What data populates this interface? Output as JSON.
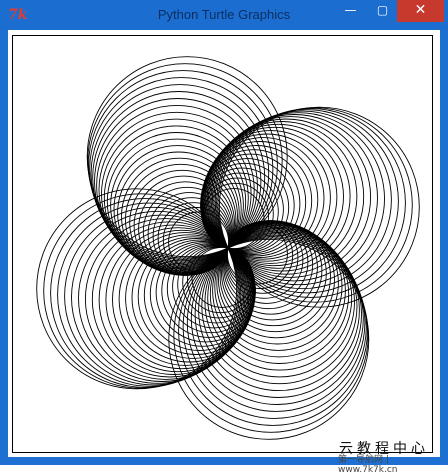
{
  "window": {
    "title": "Python Turtle Graphics",
    "icon_text": "7k",
    "controls": {
      "minimize": "—",
      "maximize": "▢",
      "close": "✕"
    }
  },
  "watermark": {
    "main": "云教程中心",
    "sub": "第一导航网 | www.7k7k.cn"
  },
  "colors": {
    "titlebar": "#1b6ed0",
    "close": "#c7382d",
    "stroke": "#000000"
  },
  "icons": [
    "tk-icon",
    "minimize-icon",
    "maximize-icon",
    "close-icon"
  ]
}
